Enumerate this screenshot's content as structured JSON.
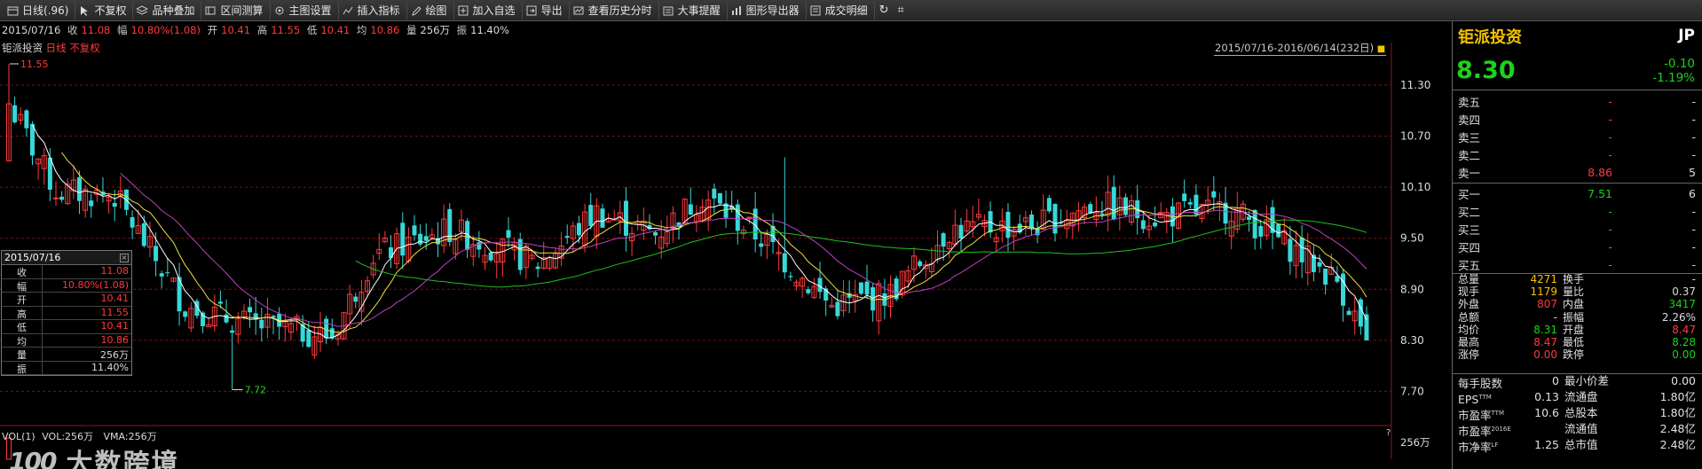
{
  "toolbar": [
    {
      "name": "daily-period-button",
      "label": "日线(.96)",
      "icon": "calendar-icon"
    },
    {
      "name": "no-adjust-button",
      "label": "不复权",
      "icon": "arrow-cursor-icon"
    },
    {
      "name": "overlay-button",
      "label": "品种叠加",
      "icon": "layers-icon"
    },
    {
      "name": "range-measure-button",
      "label": "区间测算",
      "icon": "range-icon"
    },
    {
      "name": "chart-settings-button",
      "label": "主图设置",
      "icon": "settings-icon"
    },
    {
      "name": "insert-indicator-button",
      "label": "插入指标",
      "icon": "indicator-icon"
    },
    {
      "name": "draw-button",
      "label": "绘图",
      "icon": "pencil-icon"
    },
    {
      "name": "add-watchlist-button",
      "label": "加入自选",
      "icon": "plus-icon"
    },
    {
      "name": "export-button",
      "label": "导出",
      "icon": "export-icon"
    },
    {
      "name": "history-timeshare-button",
      "label": "查看历史分时",
      "icon": "history-icon"
    },
    {
      "name": "event-reminder-button",
      "label": "大事提醒",
      "icon": "bell-icon"
    },
    {
      "name": "chart-export-button",
      "label": "图形导出器",
      "icon": "bar-chart-icon"
    },
    {
      "name": "trade-detail-button",
      "label": "成交明细",
      "icon": "list-icon"
    }
  ],
  "info": {
    "date": "2015/07/16",
    "close_k": "收",
    "close_v": "11.08",
    "amp_k": "幅",
    "amp_v": "10.80%(1.08)",
    "open_k": "开",
    "open_v": "10.41",
    "high_k": "高",
    "high_v": "11.55",
    "low_k": "低",
    "low_v": "10.41",
    "avg_k": "均",
    "avg_v": "10.86",
    "vol_k": "量",
    "vol_v": "256万",
    "turn_k": "振",
    "turn_v": "11.40%"
  },
  "subtitle": {
    "name": "钜派投资",
    "period": "日线",
    "adjust": "不复权"
  },
  "range_text": "2015/07/16-2016/06/14(232日)",
  "axis": {
    "price_ticks": [
      "11.30",
      "10.70",
      "10.10",
      "9.50",
      "8.90",
      "8.30",
      "7.70"
    ],
    "high_mark": "11.55",
    "low_mark": "7.72",
    "vol_tick": "256万"
  },
  "popup": {
    "date": "2015/07/16",
    "rows": [
      {
        "k": "收",
        "v": "11.08",
        "c": "red"
      },
      {
        "k": "幅",
        "v": "10.80%(1.08)",
        "c": "red"
      },
      {
        "k": "开",
        "v": "10.41",
        "c": "red"
      },
      {
        "k": "高",
        "v": "11.55",
        "c": "red"
      },
      {
        "k": "低",
        "v": "10.41",
        "c": "red"
      },
      {
        "k": "均",
        "v": "10.86",
        "c": "red"
      },
      {
        "k": "量",
        "v": "256万",
        "c": "white"
      },
      {
        "k": "振",
        "v": "11.40%",
        "c": "white"
      }
    ]
  },
  "vol": {
    "title": "VOL(1)",
    "vol": "VOL:256万",
    "vma": "VMA:256万"
  },
  "watermark": {
    "logo": "100",
    "text": "大数跨境"
  },
  "quote": {
    "name": "钜派投资",
    "code": "JP",
    "price": "8.30",
    "change": "-0.10",
    "change_pct": "-1.19%"
  },
  "asks": [
    {
      "k": "卖五",
      "p": "-",
      "q": "-"
    },
    {
      "k": "卖四",
      "p": "-",
      "q": "-"
    },
    {
      "k": "卖三",
      "p": "-",
      "q": "-"
    },
    {
      "k": "卖二",
      "p": "-",
      "q": "-"
    },
    {
      "k": "卖一",
      "p": "8.86",
      "q": "5"
    }
  ],
  "bids": [
    {
      "k": "买一",
      "p": "7.51",
      "q": "6"
    },
    {
      "k": "买二",
      "p": "-",
      "q": "-"
    },
    {
      "k": "买三",
      "p": "-",
      "q": "-"
    },
    {
      "k": "买四",
      "p": "-",
      "q": "-"
    },
    {
      "k": "买五",
      "p": "-",
      "q": "-"
    }
  ],
  "stats": [
    {
      "k1": "总量",
      "v1": "4271",
      "c1": "yellow",
      "k2": "换手",
      "v2": "-",
      "c2": "white"
    },
    {
      "k1": "现手",
      "v1": "1179",
      "c1": "yellow",
      "k2": "量比",
      "v2": "0.37",
      "c2": "white"
    },
    {
      "k1": "外盘",
      "v1": "807",
      "c1": "red",
      "k2": "内盘",
      "v2": "3417",
      "c2": "green"
    },
    {
      "k1": "总额",
      "v1": "-",
      "c1": "white",
      "k2": "振幅",
      "v2": "2.26%",
      "c2": "white"
    },
    {
      "k1": "均价",
      "v1": "8.31",
      "c1": "green",
      "k2": "开盘",
      "v2": "8.47",
      "c2": "red"
    },
    {
      "k1": "最高",
      "v1": "8.47",
      "c1": "red",
      "k2": "最低",
      "v2": "8.28",
      "c2": "green"
    },
    {
      "k1": "涨停",
      "v1": "0.00",
      "c1": "red",
      "k2": "跌停",
      "v2": "0.00",
      "c2": "green"
    }
  ],
  "fund": [
    {
      "k1": "每手股数",
      "sup": "",
      "v1": "0",
      "k2": "最小价差",
      "v2": "0.00"
    },
    {
      "k1": "EPS",
      "sup": "TTM",
      "v1": "0.13",
      "k2": "流通盘",
      "v2": "1.80亿"
    },
    {
      "k1": "市盈率",
      "sup": "TTM",
      "v1": "10.6",
      "k2": "总股本",
      "v2": "1.80亿"
    },
    {
      "k1": "市盈率",
      "sup": "2016E",
      "v1": "",
      "k2": "流通值",
      "v2": "2.48亿"
    },
    {
      "k1": "市净率",
      "sup": "LF",
      "v1": "1.25",
      "k2": "总市值",
      "v2": "2.48亿"
    }
  ],
  "colors": {
    "up": "#ff3b3b",
    "down": "#36d8d8",
    "ma5": "#ffffff",
    "ma10": "#f0e040",
    "ma20": "#c040c0",
    "ma60": "#20c020"
  }
}
